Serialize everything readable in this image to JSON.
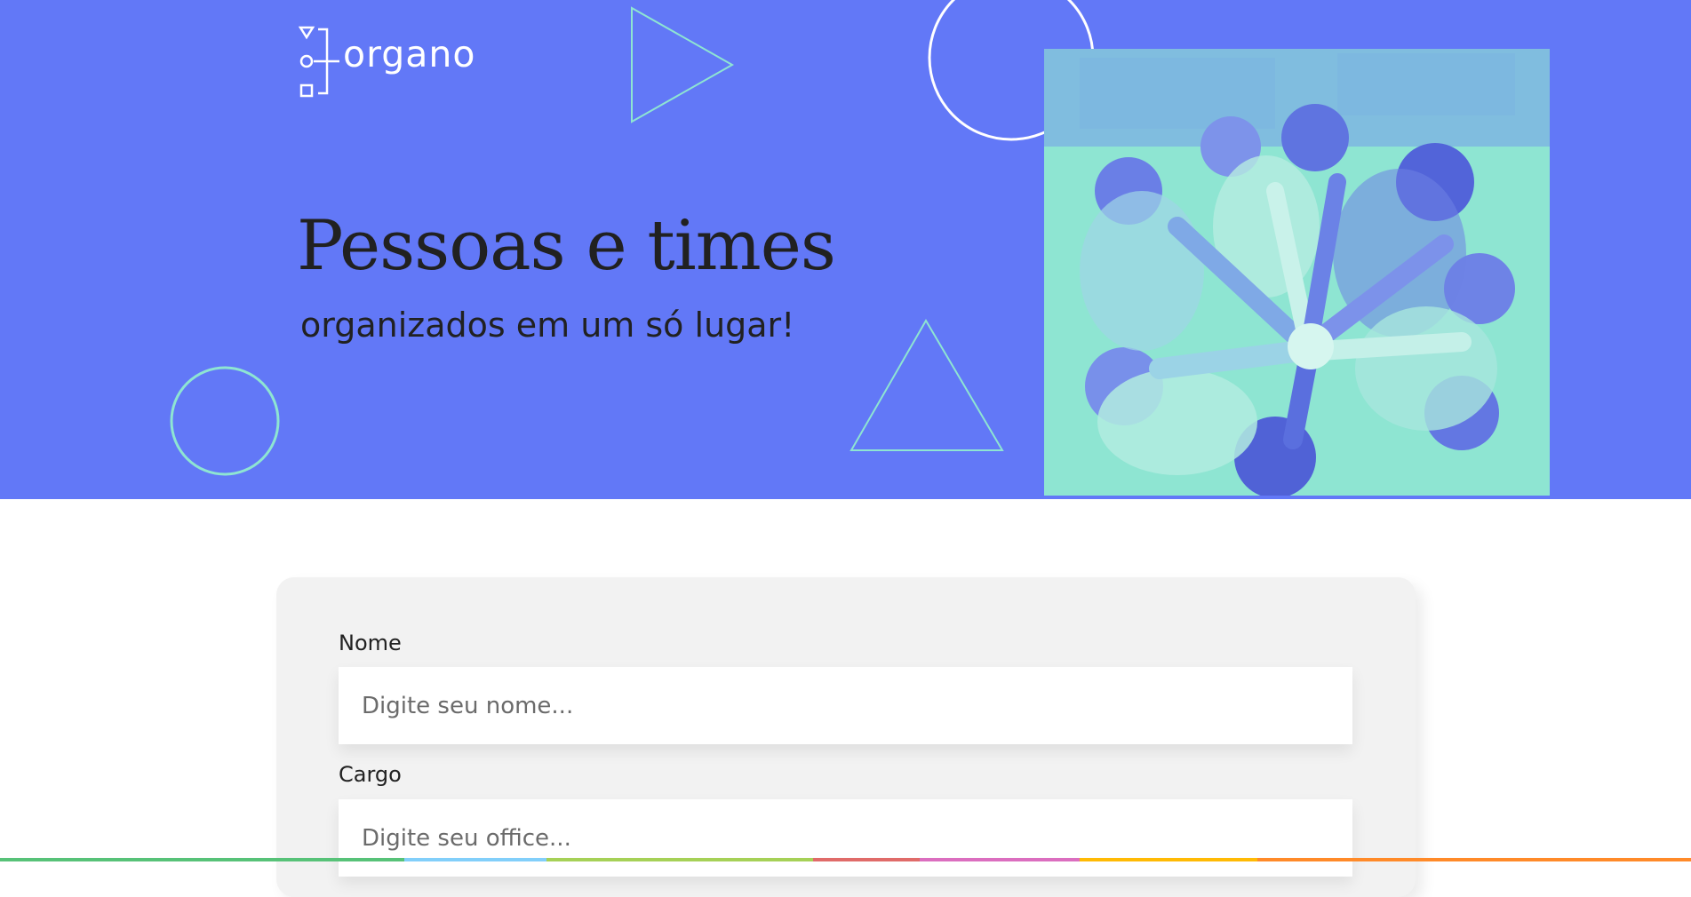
{
  "colors": {
    "banner_background": "#6278f7",
    "accent_mint": "#8ee5d2",
    "text_dark": "#212121",
    "card_background": "#f2f2f2"
  },
  "banner": {
    "logo": {
      "icon": "organo-logo-mark",
      "text": "organo"
    },
    "title": "Pessoas e times",
    "subtitle": "organizados em um só lugar!",
    "image": {
      "alt": "team-hands-together-photo"
    },
    "decorations": [
      "triangle-right-outline",
      "circle-outline-white",
      "circle-outline-mint",
      "triangle-up-outline"
    ]
  },
  "form": {
    "fields": [
      {
        "label": "Nome",
        "placeholder": "Digite seu nome...",
        "value": ""
      },
      {
        "label": "Cargo",
        "placeholder": "Digite seu office...",
        "value": ""
      }
    ]
  }
}
